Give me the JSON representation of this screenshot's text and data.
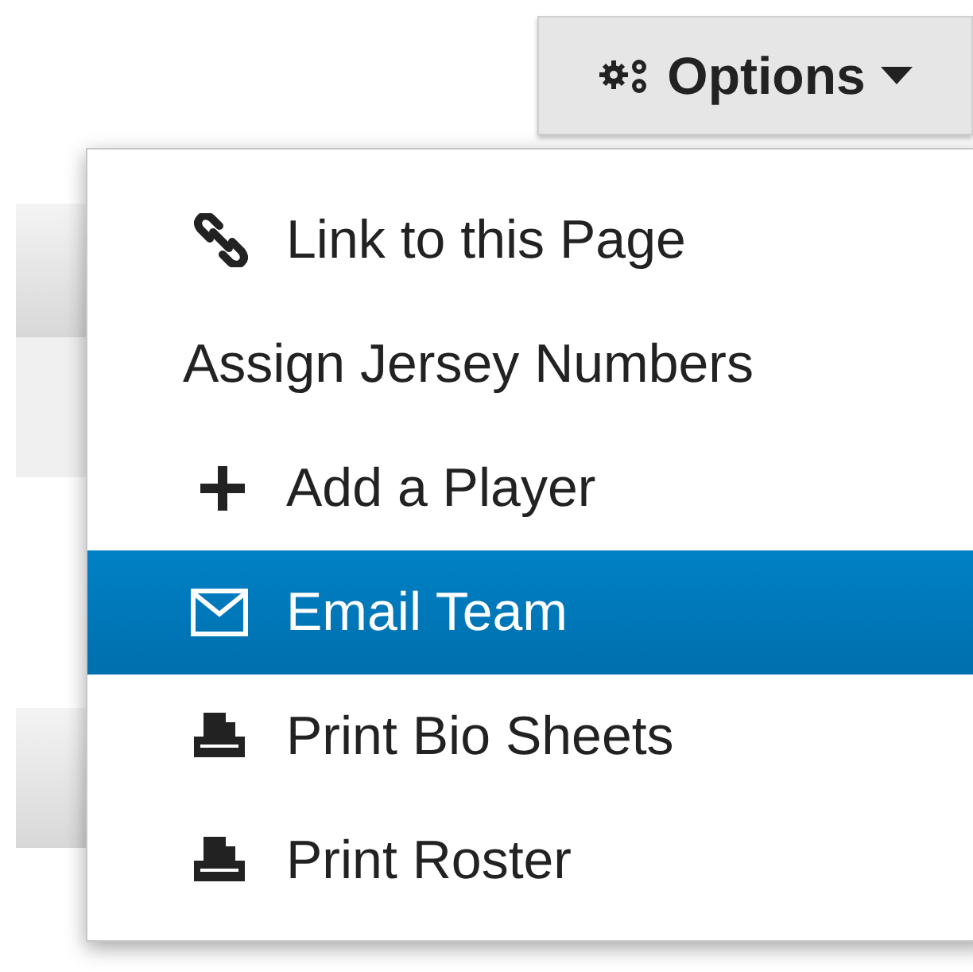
{
  "options_button": {
    "label": "Options"
  },
  "menu": {
    "items": [
      {
        "kind": "link",
        "label": "Link to this Page",
        "selected": false
      },
      {
        "kind": "plain",
        "label": "Assign Jersey Numbers",
        "selected": false
      },
      {
        "kind": "add",
        "label": "Add a Player",
        "selected": false
      },
      {
        "kind": "email",
        "label": "Email Team",
        "selected": true
      },
      {
        "kind": "print",
        "label": "Print Bio Sheets",
        "selected": false
      },
      {
        "kind": "print",
        "label": "Print Roster",
        "selected": false
      }
    ]
  }
}
